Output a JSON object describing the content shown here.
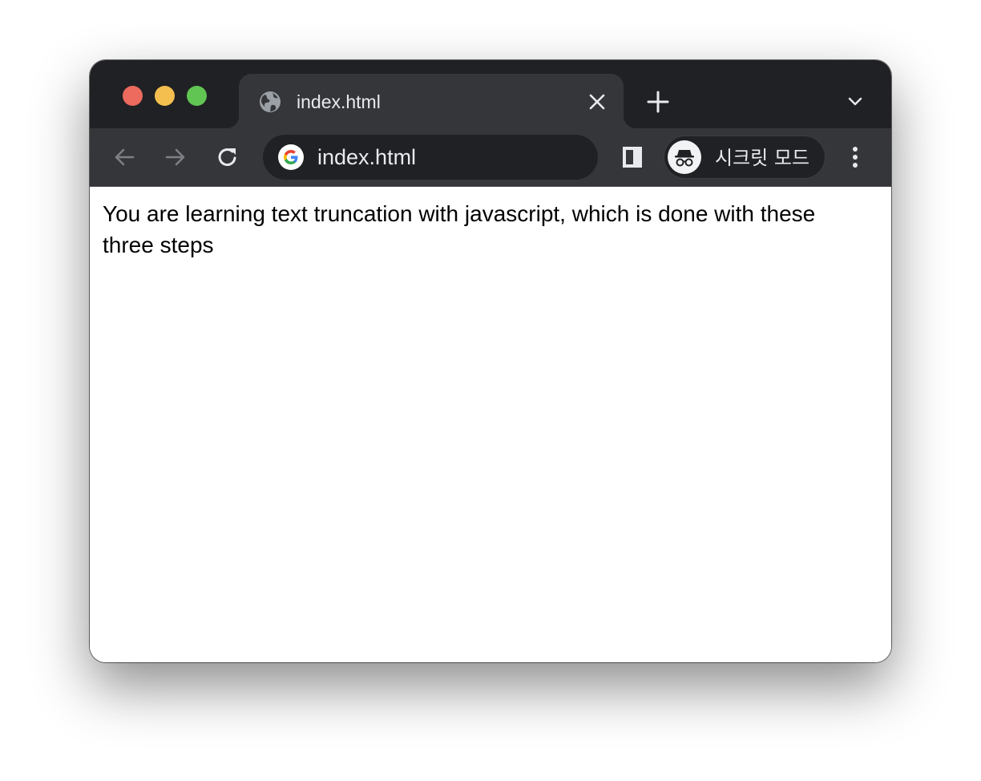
{
  "tab": {
    "title": "index.html",
    "favicon_icon": "globe-icon",
    "close_icon": "close-icon"
  },
  "tabstrip": {
    "new_tab_icon": "plus-icon",
    "tab_search_icon": "chevron-down-icon"
  },
  "toolbar": {
    "back_icon": "arrow-left-icon",
    "forward_icon": "arrow-right-icon",
    "reload_icon": "reload-icon",
    "side_panel_icon": "side-panel-icon",
    "menu_icon": "more-vert-icon"
  },
  "omnibox": {
    "search_engine_icon": "google-g-icon",
    "value": "index.html"
  },
  "incognito": {
    "avatar_icon": "incognito-icon",
    "label": "시크릿 모드"
  },
  "page": {
    "text": "You are learning text truncation with javascript, which is done with these three steps"
  },
  "colors": {
    "tabstrip_bg": "#202124",
    "toolbar_bg": "#35363a",
    "omnibox_bg": "#202124",
    "traffic_close": "#ec6a5e",
    "traffic_minimize": "#f4bf4f",
    "traffic_maximize": "#61c554"
  }
}
